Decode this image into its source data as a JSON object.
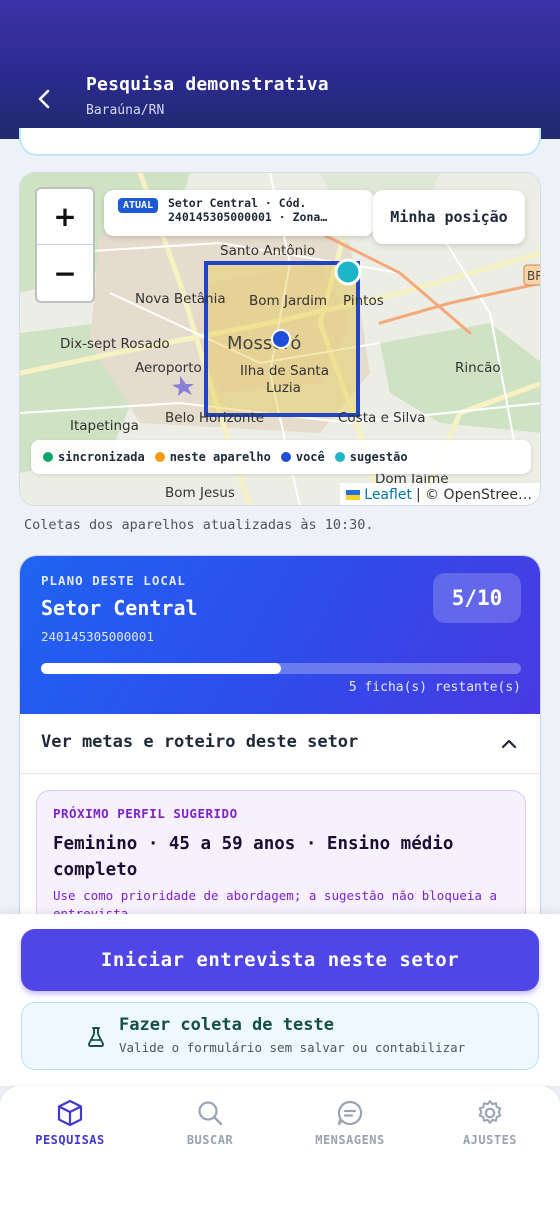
{
  "header": {
    "title": "Pesquisa demonstrativa",
    "subtitle": "Baraúna/RN"
  },
  "map": {
    "zoom_in": "+",
    "zoom_out": "−",
    "sector_badge": "ATUAL",
    "sector_line1": "Setor Central · Cód.",
    "sector_line2": "240145305000001 · Zona…",
    "my_position": "Minha posição",
    "place_labels": [
      "Santo Antônio",
      "Nova Betânia",
      "Bom Jardim",
      "Pintos",
      "Dix-sept Rosado",
      "Aeroporto",
      "Mossoró",
      "Ilha de Santa",
      "Luzia",
      "Rincão",
      "Itapetinga",
      "Belo Horizonte",
      "Costa e Silva",
      "Bom Jesus",
      "Dom Jaime",
      "BR"
    ],
    "legend": [
      {
        "label": "sincronizada",
        "color": "#10a36b"
      },
      {
        "label": "neste aparelho",
        "color": "#f59e0b"
      },
      {
        "label": "você",
        "color": "#1d4ed8"
      },
      {
        "label": "sugestão",
        "color": "#1fb5c9"
      }
    ],
    "attribution_leaflet": "Leaflet",
    "attribution_osm": "| © OpenStree…"
  },
  "updated_text": "Coletas dos aparelhos atualizadas às 10:30.",
  "plan": {
    "kicker": "PLANO DESTE LOCAL",
    "title": "Setor Central",
    "code": "240145305000001",
    "count": "5/10",
    "progress": 0.5,
    "remaining": "5 ficha(s) restante(s)",
    "goals_label": "Ver metas e roteiro deste setor"
  },
  "profile": {
    "kicker": "PRÓXIMO PERFIL SUGERIDO",
    "title": "Feminino · 45 a 59 anos · Ensino médio completo",
    "note": "Use como prioridade de abordagem; a sugestão não bloqueia a entrevista."
  },
  "actions": {
    "start": "Iniciar entrevista neste setor",
    "test_title": "Fazer coleta de teste",
    "test_sub": "Valide o formulário sem salvar ou contabilizar"
  },
  "nav": [
    {
      "label": "PESQUISAS",
      "icon": "box-icon",
      "active": true
    },
    {
      "label": "BUSCAR",
      "icon": "search-icon",
      "active": false
    },
    {
      "label": "MENSAGENS",
      "icon": "chat-icon",
      "active": false
    },
    {
      "label": "AJUSTES",
      "icon": "gear-icon",
      "active": false
    }
  ]
}
